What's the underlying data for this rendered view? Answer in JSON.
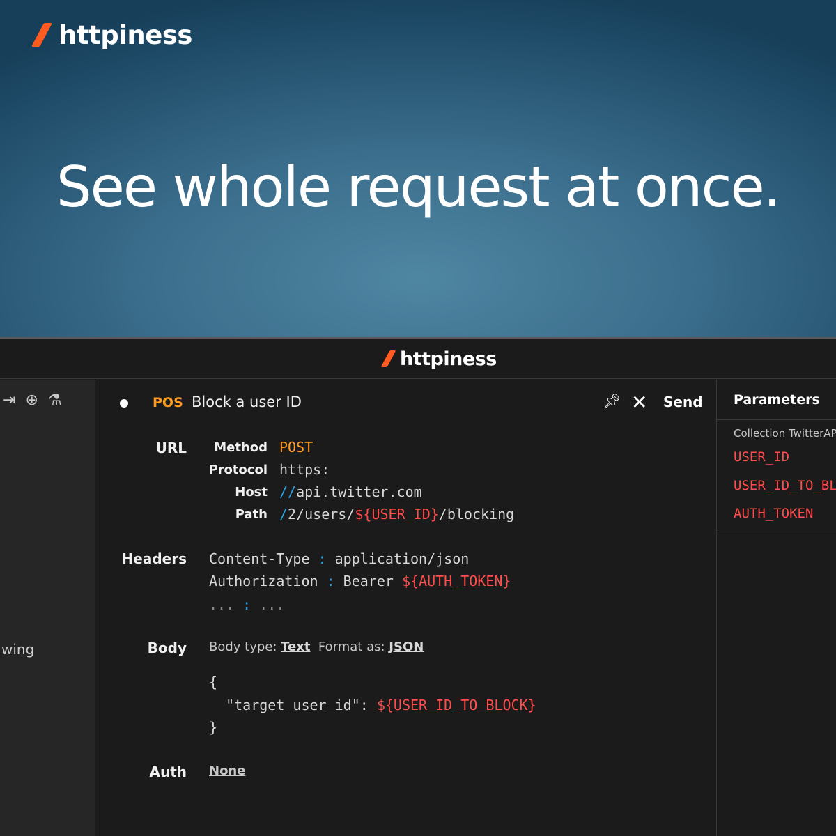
{
  "hero": {
    "brand": "httpiness",
    "headline": "See whole request at once."
  },
  "titlebar": {
    "brand": "httpiness"
  },
  "left_rail": {
    "icons": [
      "collapse-to-right-icon",
      "new-request-icon",
      "flask-icon"
    ],
    "partial_item": "wing"
  },
  "request": {
    "method_badge": "POS",
    "name": "Block a user ID",
    "send_label": "Send",
    "url": {
      "section": "URL",
      "method_label": "Method",
      "method_value": "POST",
      "protocol_label": "Protocol",
      "protocol_value": "https:",
      "host_label": "Host",
      "host_prefix": "//",
      "host_value": "api.twitter.com",
      "path_label": "Path",
      "path_prefix": "/",
      "path_part1": "2/users/",
      "path_var": "${USER_ID}",
      "path_part2": "/blocking"
    },
    "headers": {
      "section": "Headers",
      "items": [
        {
          "key": "Content-Type",
          "sep": " : ",
          "value": "application/json",
          "var": ""
        },
        {
          "key": "Authorization",
          "sep": " : ",
          "value": "Bearer ",
          "var": "${AUTH_TOKEN}"
        }
      ],
      "placeholder_key": "...",
      "placeholder_sep": " : ",
      "placeholder_value": "..."
    },
    "body": {
      "section": "Body",
      "type_label": "Body type: ",
      "type_value": "Text",
      "format_label": "  Format as: ",
      "format_value": "JSON",
      "open_brace": "{",
      "line_key": "  \"target_user_id\": ",
      "line_var": "${USER_ID_TO_BLOCK}",
      "close_brace": "}"
    },
    "auth": {
      "section": "Auth",
      "value": "None"
    }
  },
  "parameters": {
    "title": "Parameters",
    "collection": "Collection TwitterAPI",
    "items": [
      "USER_ID",
      "USER_ID_TO_BLOCK",
      "AUTH_TOKEN"
    ]
  },
  "colors": {
    "accent": "#ff5a1f",
    "method": "#ff9b1f",
    "variable": "#ff4d4d",
    "url_separator": "#2aa3e6"
  }
}
